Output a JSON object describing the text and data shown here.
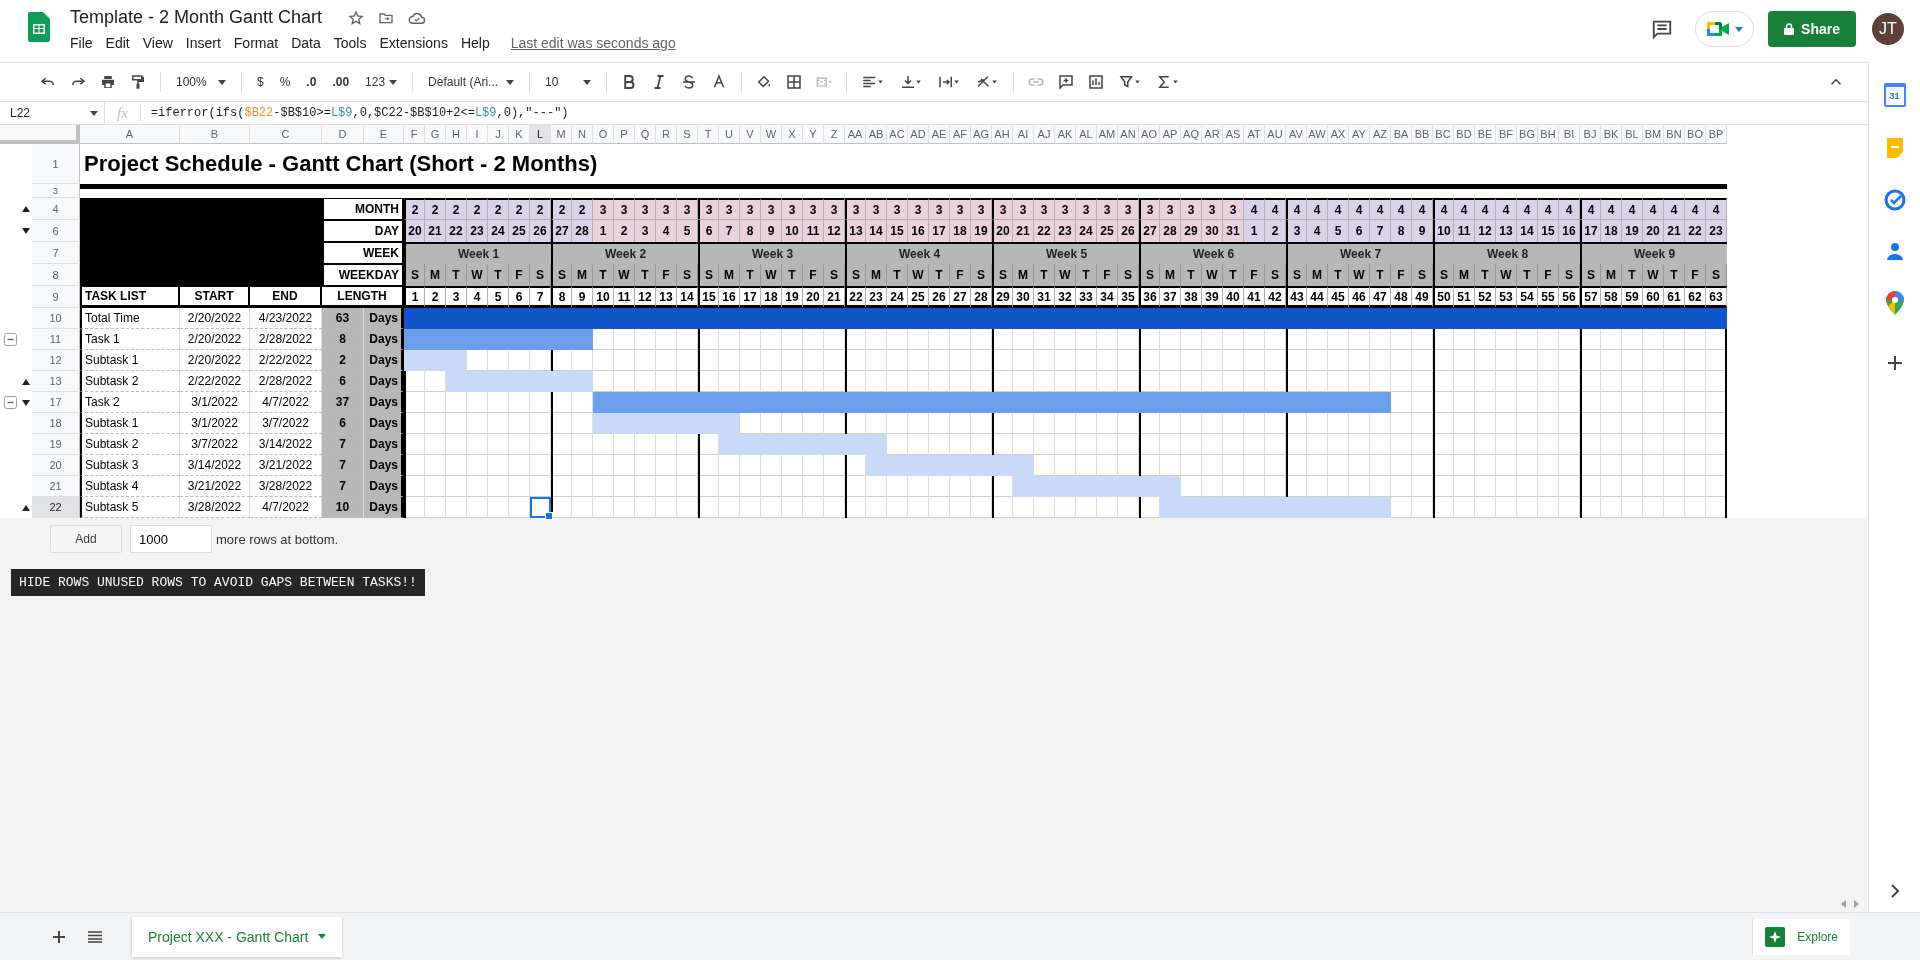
{
  "document": {
    "title": "Template - 2 Month Gantt Chart",
    "last_edit": "Last edit was seconds ago"
  },
  "menu": [
    "File",
    "Edit",
    "View",
    "Insert",
    "Format",
    "Data",
    "Tools",
    "Extensions",
    "Help"
  ],
  "share_button": "Share",
  "avatar": "JT",
  "toolbar": {
    "zoom": "100%",
    "currency": "$",
    "percent": "%",
    "decrease_decimals": ".0",
    "increase_decimals": ".00",
    "number_format": "123",
    "font": "Default (Ari...",
    "font_size": "10"
  },
  "formula_bar": {
    "cell": "L22",
    "fx": "fx",
    "formula": [
      {
        "text": "=iferror(ifs(",
        "color": "#202124"
      },
      {
        "text": "$B22",
        "color": "#e69138"
      },
      {
        "text": "-$B$10>=",
        "color": "#202124"
      },
      {
        "text": "L$9",
        "color": "#3d85c6"
      },
      {
        "text": ",0,$C22-$B$10+2<=",
        "color": "#202124"
      },
      {
        "text": "L$9",
        "color": "#3d85c6"
      },
      {
        "text": ",0),\"---\")",
        "color": "#202124"
      }
    ]
  },
  "columns": [
    {
      "label": "A",
      "selected": false
    },
    {
      "label": "B",
      "selected": false
    },
    {
      "label": "C",
      "selected": false
    },
    {
      "label": "D",
      "selected": false
    },
    {
      "label": "E",
      "selected": false
    },
    {
      "label": "F",
      "selected": false
    },
    {
      "label": "G",
      "selected": false
    },
    {
      "label": "H",
      "selected": false
    },
    {
      "label": "I",
      "selected": false
    },
    {
      "label": "J",
      "selected": false
    },
    {
      "label": "K",
      "selected": false
    },
    {
      "label": "L",
      "selected": true
    },
    {
      "label": "M",
      "selected": false
    },
    {
      "label": "N",
      "selected": false
    },
    {
      "label": "O",
      "selected": false
    },
    {
      "label": "P",
      "selected": false
    },
    {
      "label": "Q",
      "selected": false
    },
    {
      "label": "R",
      "selected": false
    },
    {
      "label": "S",
      "selected": false
    },
    {
      "label": "T",
      "selected": false
    },
    {
      "label": "U",
      "selected": false
    },
    {
      "label": "V",
      "selected": false
    },
    {
      "label": "W",
      "selected": false
    },
    {
      "label": "X",
      "selected": false
    },
    {
      "label": "Y",
      "selected": false
    },
    {
      "label": "Z",
      "selected": false
    },
    {
      "label": "AA",
      "selected": false
    },
    {
      "label": "AB",
      "selected": false
    },
    {
      "label": "AC",
      "selected": false
    },
    {
      "label": "AD",
      "selected": false
    },
    {
      "label": "AE",
      "selected": false
    },
    {
      "label": "AF",
      "selected": false
    },
    {
      "label": "AG",
      "selected": false
    },
    {
      "label": "AH",
      "selected": false
    },
    {
      "label": "AI",
      "selected": false
    },
    {
      "label": "AJ",
      "selected": false
    },
    {
      "label": "AK",
      "selected": false
    },
    {
      "label": "AL",
      "selected": false
    },
    {
      "label": "AM",
      "selected": false
    },
    {
      "label": "AN",
      "selected": false
    },
    {
      "label": "AO",
      "selected": false
    },
    {
      "label": "AP",
      "selected": false
    },
    {
      "label": "AQ",
      "selected": false
    },
    {
      "label": "AR",
      "selected": false
    },
    {
      "label": "AS",
      "selected": false
    },
    {
      "label": "AT",
      "selected": false
    },
    {
      "label": "AU",
      "selected": false
    },
    {
      "label": "AV",
      "selected": false
    },
    {
      "label": "AW",
      "selected": false
    },
    {
      "label": "AX",
      "selected": false
    },
    {
      "label": "AY",
      "selected": false
    },
    {
      "label": "AZ",
      "selected": false
    },
    {
      "label": "BA",
      "selected": false
    },
    {
      "label": "BB",
      "selected": false
    },
    {
      "label": "BC",
      "selected": false
    },
    {
      "label": "BD",
      "selected": false
    },
    {
      "label": "BE",
      "selected": false
    },
    {
      "label": "BF",
      "selected": false
    },
    {
      "label": "BG",
      "selected": false
    },
    {
      "label": "BH",
      "selected": false
    },
    {
      "label": "BI",
      "selected": false
    },
    {
      "label": "BJ",
      "selected": false
    },
    {
      "label": "BK",
      "selected": false
    },
    {
      "label": "BL",
      "selected": false
    },
    {
      "label": "BM",
      "selected": false
    },
    {
      "label": "BN",
      "selected": false
    },
    {
      "label": "BO",
      "selected": false
    },
    {
      "label": "BP",
      "selected": false
    }
  ],
  "rows": [
    {
      "label": "1",
      "selected": false,
      "group_toggle": false,
      "kind": "plain"
    },
    {
      "label": "3",
      "selected": false,
      "group_toggle": false,
      "kind": "plain"
    },
    {
      "label": "4",
      "selected": false,
      "group_toggle": false,
      "kind": "marker-up"
    },
    {
      "label": "6",
      "selected": false,
      "group_toggle": false,
      "kind": "marker-down"
    },
    {
      "label": "7",
      "selected": false,
      "group_toggle": false,
      "kind": "plain"
    },
    {
      "label": "8",
      "selected": false,
      "group_toggle": false,
      "kind": "plain"
    },
    {
      "label": "9",
      "selected": false,
      "group_toggle": false,
      "kind": "plain"
    },
    {
      "label": "10",
      "selected": false,
      "group_toggle": false,
      "kind": "plain"
    },
    {
      "label": "11",
      "selected": false,
      "group_toggle": true,
      "kind": "plain"
    },
    {
      "label": "12",
      "selected": false,
      "group_toggle": false,
      "kind": "plain"
    },
    {
      "label": "13",
      "selected": false,
      "group_toggle": false,
      "kind": "marker-up"
    },
    {
      "label": "17",
      "selected": false,
      "group_toggle": true,
      "kind": "marker-down"
    },
    {
      "label": "18",
      "selected": false,
      "group_toggle": false,
      "kind": "plain"
    },
    {
      "label": "19",
      "selected": false,
      "group_toggle": false,
      "kind": "plain"
    },
    {
      "label": "20",
      "selected": false,
      "group_toggle": false,
      "kind": "plain"
    },
    {
      "label": "21",
      "selected": false,
      "group_toggle": false,
      "kind": "plain"
    },
    {
      "label": "22",
      "selected": true,
      "group_toggle": false,
      "kind": "marker-up"
    }
  ],
  "sheet_title": "Project Schedule - Gantt Chart (Short - 2 Months)",
  "header_labels": [
    "MONTH",
    "DAY",
    "WEEK",
    "WEEKDAY"
  ],
  "table_headers": {
    "task": "TASK LIST",
    "start": "START",
    "end": "END",
    "length": "LENGTH"
  },
  "weeks": [
    "Week 1",
    "Week 2",
    "Week 3",
    "Week 4",
    "Week 5",
    "Week 6",
    "Week 7",
    "Week 8",
    "Week 9"
  ],
  "days": [
    {
      "month": "2",
      "day": "20",
      "weekday": "S",
      "number": "1",
      "color": "#d9d2e9"
    },
    {
      "month": "2",
      "day": "21",
      "weekday": "M",
      "number": "2",
      "color": "#d9d2e9"
    },
    {
      "month": "2",
      "day": "22",
      "weekday": "T",
      "number": "3",
      "color": "#d9d2e9"
    },
    {
      "month": "2",
      "day": "23",
      "weekday": "W",
      "number": "4",
      "color": "#d9d2e9"
    },
    {
      "month": "2",
      "day": "24",
      "weekday": "T",
      "number": "5",
      "color": "#d9d2e9"
    },
    {
      "month": "2",
      "day": "25",
      "weekday": "F",
      "number": "6",
      "color": "#d9d2e9"
    },
    {
      "month": "2",
      "day": "26",
      "weekday": "S",
      "number": "7",
      "color": "#d9d2e9"
    },
    {
      "month": "2",
      "day": "27",
      "weekday": "S",
      "number": "8",
      "color": "#d9d2e9"
    },
    {
      "month": "2",
      "day": "28",
      "weekday": "M",
      "number": "9",
      "color": "#d9d2e9"
    },
    {
      "month": "3",
      "day": "1",
      "weekday": "T",
      "number": "10",
      "color": "#ead1dc"
    },
    {
      "month": "3",
      "day": "2",
      "weekday": "W",
      "number": "11",
      "color": "#ead1dc"
    },
    {
      "month": "3",
      "day": "3",
      "weekday": "T",
      "number": "12",
      "color": "#ead1dc"
    },
    {
      "month": "3",
      "day": "4",
      "weekday": "F",
      "number": "13",
      "color": "#ead1dc"
    },
    {
      "month": "3",
      "day": "5",
      "weekday": "S",
      "number": "14",
      "color": "#ead1dc"
    },
    {
      "month": "3",
      "day": "6",
      "weekday": "S",
      "number": "15",
      "color": "#ead1dc"
    },
    {
      "month": "3",
      "day": "7",
      "weekday": "M",
      "number": "16",
      "color": "#ead1dc"
    },
    {
      "month": "3",
      "day": "8",
      "weekday": "T",
      "number": "17",
      "color": "#ead1dc"
    },
    {
      "month": "3",
      "day": "9",
      "weekday": "W",
      "number": "18",
      "color": "#ead1dc"
    },
    {
      "month": "3",
      "day": "10",
      "weekday": "T",
      "number": "19",
      "color": "#ead1dc"
    },
    {
      "month": "3",
      "day": "11",
      "weekday": "F",
      "number": "20",
      "color": "#ead1dc"
    },
    {
      "month": "3",
      "day": "12",
      "weekday": "S",
      "number": "21",
      "color": "#ead1dc"
    },
    {
      "month": "3",
      "day": "13",
      "weekday": "S",
      "number": "22",
      "color": "#ead1dc"
    },
    {
      "month": "3",
      "day": "14",
      "weekday": "M",
      "number": "23",
      "color": "#ead1dc"
    },
    {
      "month": "3",
      "day": "15",
      "weekday": "T",
      "number": "24",
      "color": "#ead1dc"
    },
    {
      "month": "3",
      "day": "16",
      "weekday": "W",
      "number": "25",
      "color": "#ead1dc"
    },
    {
      "month": "3",
      "day": "17",
      "weekday": "T",
      "number": "26",
      "color": "#ead1dc"
    },
    {
      "month": "3",
      "day": "18",
      "weekday": "F",
      "number": "27",
      "color": "#ead1dc"
    },
    {
      "month": "3",
      "day": "19",
      "weekday": "S",
      "number": "28",
      "color": "#ead1dc"
    },
    {
      "month": "3",
      "day": "20",
      "weekday": "S",
      "number": "29",
      "color": "#ead1dc"
    },
    {
      "month": "3",
      "day": "21",
      "weekday": "M",
      "number": "30",
      "color": "#ead1dc"
    },
    {
      "month": "3",
      "day": "22",
      "weekday": "T",
      "number": "31",
      "color": "#ead1dc"
    },
    {
      "month": "3",
      "day": "23",
      "weekday": "W",
      "number": "32",
      "color": "#ead1dc"
    },
    {
      "month": "3",
      "day": "24",
      "weekday": "T",
      "number": "33",
      "color": "#ead1dc"
    },
    {
      "month": "3",
      "day": "25",
      "weekday": "F",
      "number": "34",
      "color": "#ead1dc"
    },
    {
      "month": "3",
      "day": "26",
      "weekday": "S",
      "number": "35",
      "color": "#ead1dc"
    },
    {
      "month": "3",
      "day": "27",
      "weekday": "S",
      "number": "36",
      "color": "#ead1dc"
    },
    {
      "month": "3",
      "day": "28",
      "weekday": "M",
      "number": "37",
      "color": "#ead1dc"
    },
    {
      "month": "3",
      "day": "29",
      "weekday": "T",
      "number": "38",
      "color": "#ead1dc"
    },
    {
      "month": "3",
      "day": "30",
      "weekday": "W",
      "number": "39",
      "color": "#ead1dc"
    },
    {
      "month": "3",
      "day": "31",
      "weekday": "T",
      "number": "40",
      "color": "#ead1dc"
    },
    {
      "month": "4",
      "day": "1",
      "weekday": "F",
      "number": "41",
      "color": "#d9d2e9"
    },
    {
      "month": "4",
      "day": "2",
      "weekday": "S",
      "number": "42",
      "color": "#d9d2e9"
    },
    {
      "month": "4",
      "day": "3",
      "weekday": "S",
      "number": "43",
      "color": "#d9d2e9"
    },
    {
      "month": "4",
      "day": "4",
      "weekday": "M",
      "number": "44",
      "color": "#d9d2e9"
    },
    {
      "month": "4",
      "day": "5",
      "weekday": "T",
      "number": "45",
      "color": "#d9d2e9"
    },
    {
      "month": "4",
      "day": "6",
      "weekday": "W",
      "number": "46",
      "color": "#d9d2e9"
    },
    {
      "month": "4",
      "day": "7",
      "weekday": "T",
      "number": "47",
      "color": "#d9d2e9"
    },
    {
      "month": "4",
      "day": "8",
      "weekday": "F",
      "number": "48",
      "color": "#d9d2e9"
    },
    {
      "month": "4",
      "day": "9",
      "weekday": "S",
      "number": "49",
      "color": "#d9d2e9"
    },
    {
      "month": "4",
      "day": "10",
      "weekday": "S",
      "number": "50",
      "color": "#d9d2e9"
    },
    {
      "month": "4",
      "day": "11",
      "weekday": "M",
      "number": "51",
      "color": "#d9d2e9"
    },
    {
      "month": "4",
      "day": "12",
      "weekday": "T",
      "number": "52",
      "color": "#d9d2e9"
    },
    {
      "month": "4",
      "day": "13",
      "weekday": "W",
      "number": "53",
      "color": "#d9d2e9"
    },
    {
      "month": "4",
      "day": "14",
      "weekday": "T",
      "number": "54",
      "color": "#d9d2e9"
    },
    {
      "month": "4",
      "day": "15",
      "weekday": "F",
      "number": "55",
      "color": "#d9d2e9"
    },
    {
      "month": "4",
      "day": "16",
      "weekday": "S",
      "number": "56",
      "color": "#d9d2e9"
    },
    {
      "month": "4",
      "day": "17",
      "weekday": "S",
      "number": "57",
      "color": "#d9d2e9"
    },
    {
      "month": "4",
      "day": "18",
      "weekday": "M",
      "number": "58",
      "color": "#d9d2e9"
    },
    {
      "month": "4",
      "day": "19",
      "weekday": "T",
      "number": "59",
      "color": "#d9d2e9"
    },
    {
      "month": "4",
      "day": "20",
      "weekday": "W",
      "number": "60",
      "color": "#d9d2e9"
    },
    {
      "month": "4",
      "day": "21",
      "weekday": "T",
      "number": "61",
      "color": "#d9d2e9"
    },
    {
      "month": "4",
      "day": "22",
      "weekday": "F",
      "number": "62",
      "color": "#d9d2e9"
    },
    {
      "month": "4",
      "day": "23",
      "weekday": "S",
      "number": "63",
      "color": "#d9d2e9"
    }
  ],
  "tasks": [
    {
      "name": "Total Time",
      "start": "2/20/2022",
      "end": "4/23/2022",
      "length": "63",
      "unit": "Days",
      "kind": "total"
    },
    {
      "name": "Task 1",
      "start": "2/20/2022",
      "end": "2/28/2022",
      "length": "8",
      "unit": "Days",
      "kind": "task"
    },
    {
      "name": "Subtask 1",
      "start": "2/20/2022",
      "end": "2/22/2022",
      "length": "2",
      "unit": "Days",
      "kind": "subtask"
    },
    {
      "name": "Subtask 2",
      "start": "2/22/2022",
      "end": "2/28/2022",
      "length": "6",
      "unit": "Days",
      "kind": "subtask"
    },
    {
      "name": "Task 2",
      "start": "3/1/2022",
      "end": "4/7/2022",
      "length": "37",
      "unit": "Days",
      "kind": "task"
    },
    {
      "name": "Subtask 1",
      "start": "3/1/2022",
      "end": "3/7/2022",
      "length": "6",
      "unit": "Days",
      "kind": "subtask"
    },
    {
      "name": "Subtask 2",
      "start": "3/7/2022",
      "end": "3/14/2022",
      "length": "7",
      "unit": "Days",
      "kind": "subtask"
    },
    {
      "name": "Subtask 3",
      "start": "3/14/2022",
      "end": "3/21/2022",
      "length": "7",
      "unit": "Days",
      "kind": "subtask"
    },
    {
      "name": "Subtask 4",
      "start": "3/21/2022",
      "end": "3/28/2022",
      "length": "7",
      "unit": "Days",
      "kind": "subtask"
    },
    {
      "name": "Subtask 5",
      "start": "3/28/2022",
      "end": "4/7/2022",
      "length": "10",
      "unit": "Days",
      "kind": "subtask"
    }
  ],
  "add_rows": {
    "button": "Add",
    "value": "1000",
    "suffix": "more rows at bottom."
  },
  "note": "HIDE ROWS UNUSED ROWS TO AVOID GAPS BETWEEN TASKS!!",
  "sheet_tabs": [
    {
      "label": "Project XXX - Gantt Chart",
      "selected": true
    }
  ],
  "side_panel": {
    "calendar_day": "31"
  },
  "explore_button": "Explore"
}
